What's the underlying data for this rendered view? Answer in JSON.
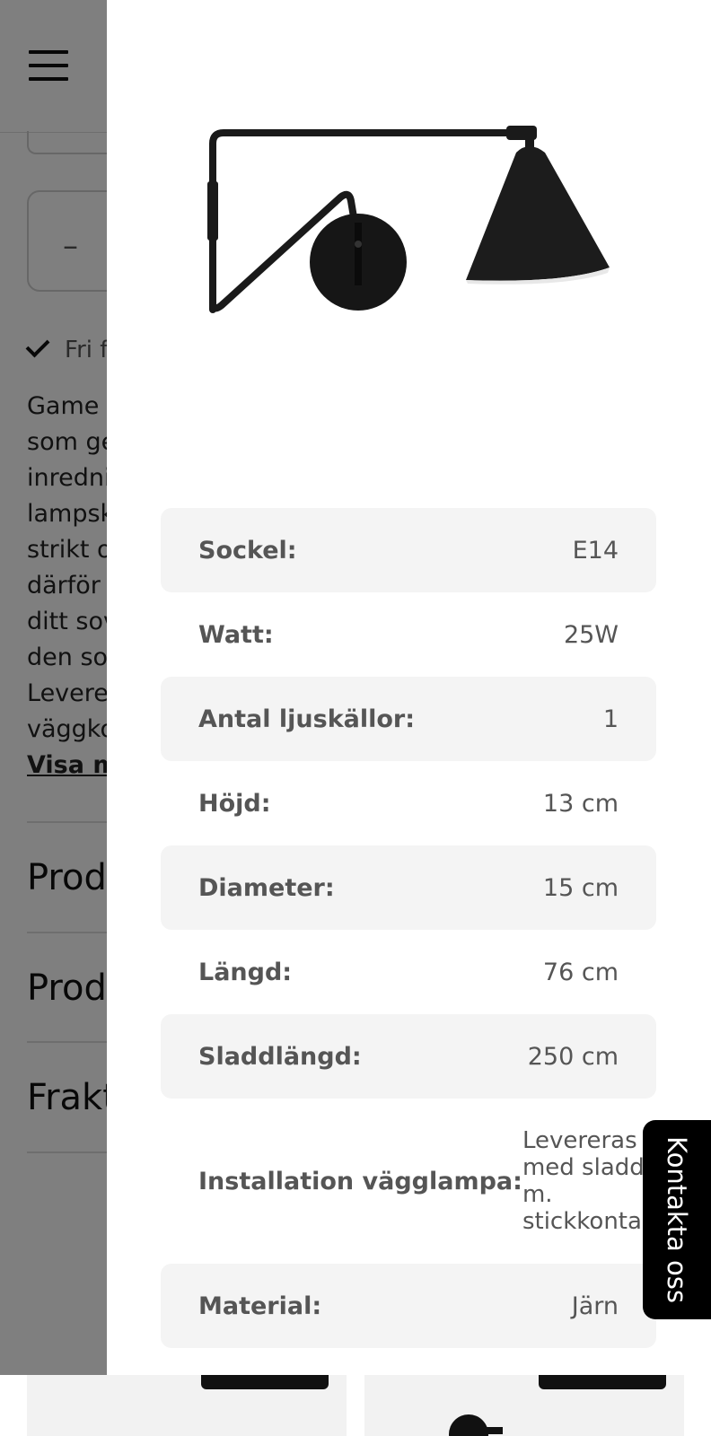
{
  "background": {
    "free_shipping_text": "Fri f",
    "quantity_minus": "–",
    "description_lines": [
      "Game",
      "som ge",
      "inredni",
      "lampsk",
      "strikt o",
      "därför",
      "ditt sov",
      "den so",
      "Levere",
      "väggko"
    ],
    "read_more": "Visa m",
    "accordions": [
      "Produ",
      "Produ",
      "Frakt"
    ]
  },
  "drawer": {
    "product_image_icon": "wall-lamp-image",
    "specs": [
      {
        "label": "Sockel:",
        "value": "E14"
      },
      {
        "label": "Watt:",
        "value": "25W"
      },
      {
        "label": "Antal ljuskällor:",
        "value": "1"
      },
      {
        "label": "Höjd:",
        "value": "13 cm"
      },
      {
        "label": "Diameter:",
        "value": "15 cm"
      },
      {
        "label": "Längd:",
        "value": "76 cm"
      },
      {
        "label": "Sladdlängd:",
        "value": "250 cm"
      },
      {
        "label": "Installation vägglampa:",
        "value": "Levereras med sladd m. stickkontakt"
      },
      {
        "label": "Material:",
        "value": "Järn"
      }
    ]
  },
  "contact_tab": {
    "label": "Kontakta oss"
  },
  "colors": {
    "overlay": "#808080",
    "row_alt": "#f4f4f4",
    "contact_bg": "#000000"
  }
}
